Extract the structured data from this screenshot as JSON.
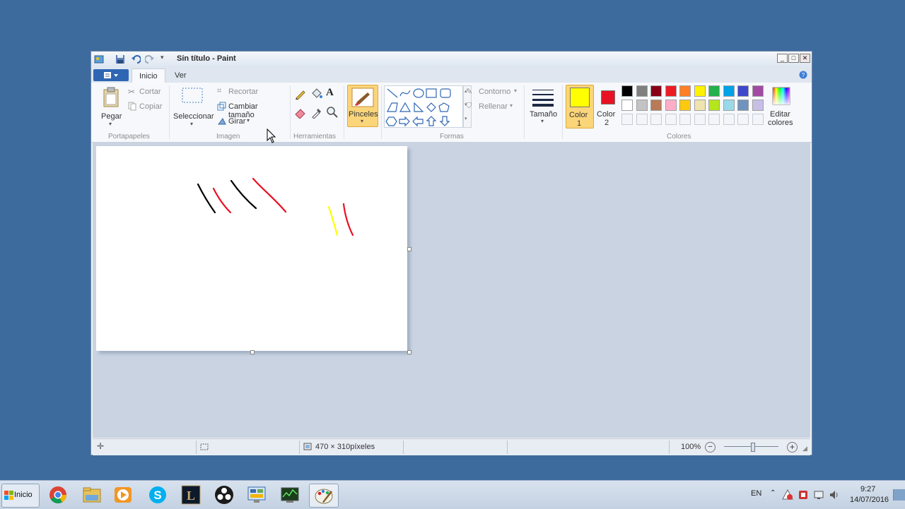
{
  "window": {
    "title": "Sin título - Paint",
    "minimize": "_",
    "maximize": "□",
    "close": "✕"
  },
  "ribbon_tabs": {
    "file_icon": "file-menu-icon",
    "inicio": "Inicio",
    "ver": "Ver",
    "help_icon": "help-icon"
  },
  "clipboard": {
    "pegar": "Pegar",
    "cortar": "Cortar",
    "copiar": "Copiar",
    "group": "Portapapeles"
  },
  "image": {
    "seleccionar": "Seleccionar",
    "recortar": "Recortar",
    "cambiar_tamano": "Cambiar tamaño",
    "girar": "Girar",
    "group": "Imagen"
  },
  "tools": {
    "text_tool": "A",
    "group": "Herramientas"
  },
  "brushes": {
    "label": "Pinceles"
  },
  "shapes": {
    "contorno": "Contorno",
    "rellenar": "Rellenar",
    "group": "Formas"
  },
  "size": {
    "label": "Tamaño"
  },
  "colors": {
    "color1_label": "Color",
    "color1_num": "1",
    "color2_label": "Color",
    "color2_num": "2",
    "color1": "#ffff00",
    "color2": "#e81123",
    "editar_1": "Editar",
    "editar_2": "colores",
    "group": "Colores",
    "palette_row1": [
      "#000000",
      "#7f7f7f",
      "#880015",
      "#ed1c24",
      "#ff7f27",
      "#fff200",
      "#22b14c",
      "#00a2e8",
      "#3f48cc",
      "#a349a4"
    ],
    "palette_row2": [
      "#ffffff",
      "#c3c3c3",
      "#b97a57",
      "#ffaec9",
      "#ffc90e",
      "#efe4b0",
      "#b5e61d",
      "#99d9ea",
      "#7092be",
      "#c8bfe7"
    ]
  },
  "status": {
    "dimensions": "470 × 310píxeles",
    "zoom": "100%",
    "zoom_out": "−",
    "zoom_in": "+"
  },
  "taskbar": {
    "start": "Inicio",
    "lang": "EN",
    "time": "9:27",
    "date": "14/07/2016",
    "apps": [
      "chrome-icon",
      "file-explorer-icon",
      "media-player-icon",
      "skype-icon",
      "league-of-legends-icon",
      "obs-icon",
      "control-panel-icon",
      "task-manager-icon",
      "paint-icon"
    ]
  }
}
